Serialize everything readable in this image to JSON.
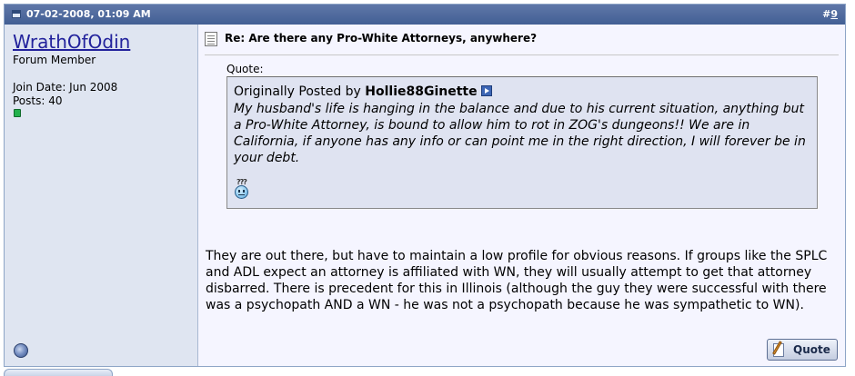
{
  "post": {
    "date": "07-02-2008, 01:09 AM",
    "number_prefix": "#",
    "number": "9"
  },
  "user": {
    "name": "WrathOfOdin",
    "title": "Forum Member",
    "join_date": "Join Date: Jun 2008",
    "posts": "Posts: 40"
  },
  "content": {
    "title": "Re: Are there any Pro-White Attorneys, anywhere?",
    "quote_label": "Quote:",
    "quote": {
      "originally_posted_by": "Originally Posted by",
      "author": "Hollie88Ginette",
      "text": "My husband's life is hanging in the balance and due to his current situation, anything but a Pro-White Attorney, is bound to allow him to rot in ZOG's dungeons!! We are in California, if anyone has any info or can point me in the right direction, I will forever be in your debt.",
      "smilie_caption": "???"
    },
    "message": "They are out there, but have to maintain a low profile for obvious reasons. If groups like the SPLC and ADL expect an attorney is affiliated with WN, they will usually attempt to get that attorney disbarred. There is precedent for this in Illinois (although the guy they were successful with there was a psychopath AND a WN - he was not a psychopath because he was sympathetic to WN)."
  },
  "buttons": {
    "quote_label": "Quote"
  },
  "icons": {
    "date": "post-date-icon",
    "online": "online-status-icon",
    "offline": "user-offline-icon",
    "post": "post-title-icon",
    "view_post": "view-post-icon",
    "smilie": "confused-smilie-icon",
    "quote_button": "quote-pen-icon"
  },
  "colors": {
    "header": "#4f6a9f",
    "user_column": "#dfe5f1",
    "content": "#f5f5ff",
    "quote_box": "#dfe3f1",
    "username": "#22229c",
    "online": "#22b14c"
  }
}
